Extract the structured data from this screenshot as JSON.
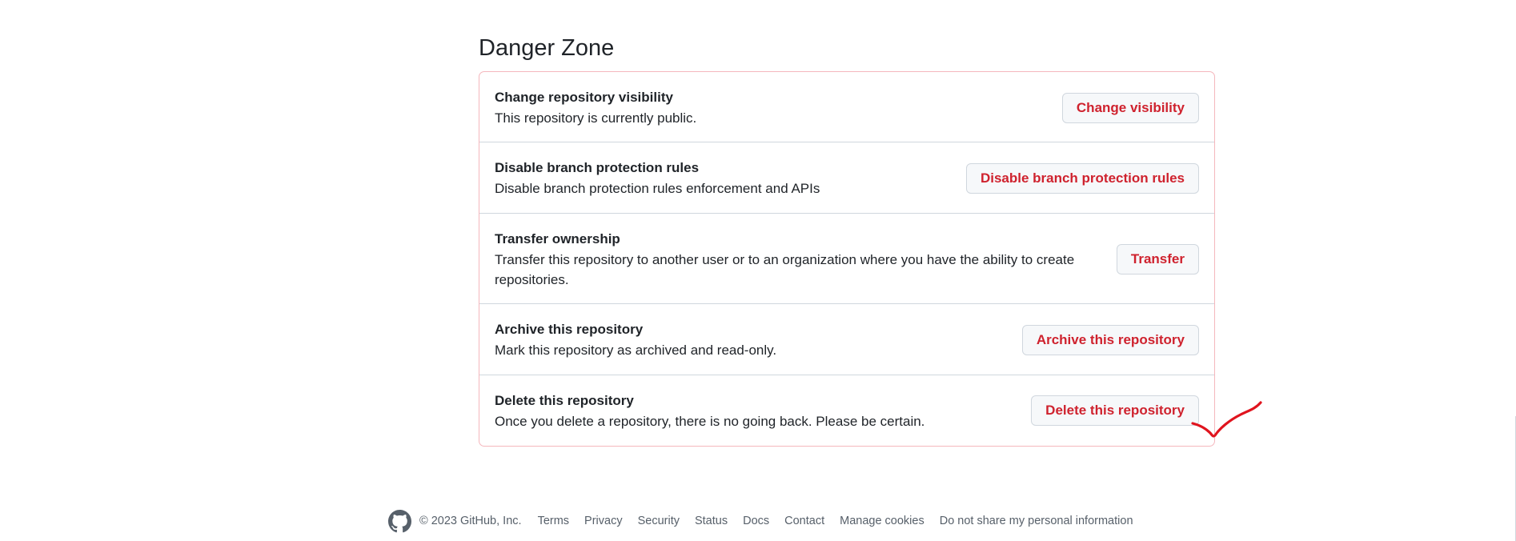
{
  "title": "Danger Zone",
  "rows": [
    {
      "title": "Change repository visibility",
      "description": "This repository is currently public.",
      "button": "Change visibility"
    },
    {
      "title": "Disable branch protection rules",
      "description": "Disable branch protection rules enforcement and APIs",
      "button": "Disable branch protection rules"
    },
    {
      "title": "Transfer ownership",
      "description": "Transfer this repository to another user or to an organization where you have the ability to create repositories.",
      "button": "Transfer"
    },
    {
      "title": "Archive this repository",
      "description": "Mark this repository as archived and read-only.",
      "button": "Archive this repository"
    },
    {
      "title": "Delete this repository",
      "description": "Once you delete a repository, there is no going back. Please be certain.",
      "button": "Delete this repository"
    }
  ],
  "footer": {
    "logo_icon": "github-icon",
    "copyright": "© 2023 GitHub, Inc.",
    "links": [
      "Terms",
      "Privacy",
      "Security",
      "Status",
      "Docs",
      "Contact",
      "Manage cookies",
      "Do not share my personal information"
    ]
  },
  "colors": {
    "danger": "#cf222e",
    "danger_border": "#f5b7bd",
    "annotation": "#e0141e"
  }
}
